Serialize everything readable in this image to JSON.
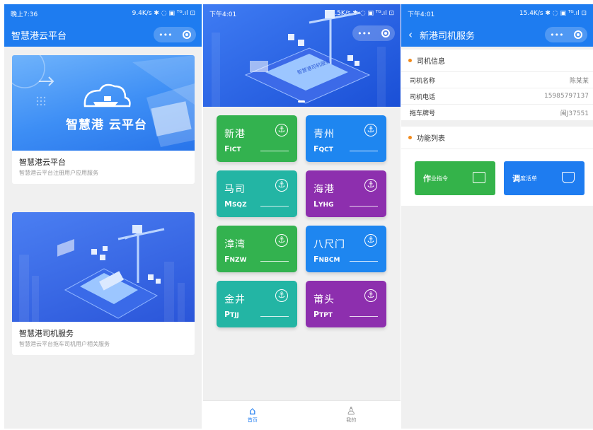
{
  "phone1": {
    "status": {
      "time": "晚上7:36",
      "right": "9.4K/s ✱ ◌ ▣ ᵀᴳ.ıl ⊡"
    },
    "title": "智慧港云平台",
    "capsule": {
      "more": "•••"
    },
    "cards": [
      {
        "banner_text": "智慧港 云平台",
        "title": "智慧港云平台",
        "subtitle": "智慧港云平台注册用户应用服务"
      },
      {
        "banner_text": "智慧港司机服务",
        "title": "智慧港司机服务",
        "subtitle": "智慧港云平台拖车司机用户相关服务"
      }
    ]
  },
  "phone2": {
    "status": {
      "time": "下午4:01",
      "right": "2.5K/s ✱ ◌ ▣ ᵀᴳ.ıl ⊡"
    },
    "capsule": {
      "more": "•••"
    },
    "hero_text": "智慧港司机服务",
    "ports": [
      {
        "name": "新港",
        "code_first": "F",
        "code_rest": "ICT",
        "color": "green"
      },
      {
        "name": "青州",
        "code_first": "F",
        "code_rest": "QCT",
        "color": "blue"
      },
      {
        "name": "马司",
        "code_first": "M",
        "code_rest": "SQZ",
        "color": "teal"
      },
      {
        "name": "海港",
        "code_first": "L",
        "code_rest": "YHG",
        "color": "purple"
      },
      {
        "name": "漳湾",
        "code_first": "F",
        "code_rest": "NZW",
        "color": "green"
      },
      {
        "name": "八尺门",
        "code_first": "F",
        "code_rest": "NBCM",
        "color": "blue"
      },
      {
        "name": "金井",
        "code_first": "P",
        "code_rest": "TJJ",
        "color": "teal"
      },
      {
        "name": "莆头",
        "code_first": "P",
        "code_rest": "TPT",
        "color": "purple"
      }
    ],
    "tabs": [
      {
        "label": "首页",
        "icon": "home-icon"
      },
      {
        "label": "我的",
        "icon": "user-icon"
      }
    ]
  },
  "phone3": {
    "status": {
      "time": "下午4:01",
      "right": "15.4K/s ✱ ◌ ▣ ᵀᴳ.ıl ⊡"
    },
    "title": "新港司机服务",
    "capsule": {
      "more": "•••"
    },
    "driver_section": "司机信息",
    "driver_rows": [
      {
        "label": "司机名称",
        "value": "陈某某"
      },
      {
        "label": "司机电话",
        "value": "15985797137"
      },
      {
        "label": "拖车牌号",
        "value": "闽J37551"
      }
    ],
    "function_section": "功能列表",
    "functions": [
      {
        "first": "作",
        "rest": "业指令",
        "color": "#34b34a"
      },
      {
        "first": "调",
        "rest": "度活单",
        "color": "#1e7cf0"
      }
    ]
  }
}
